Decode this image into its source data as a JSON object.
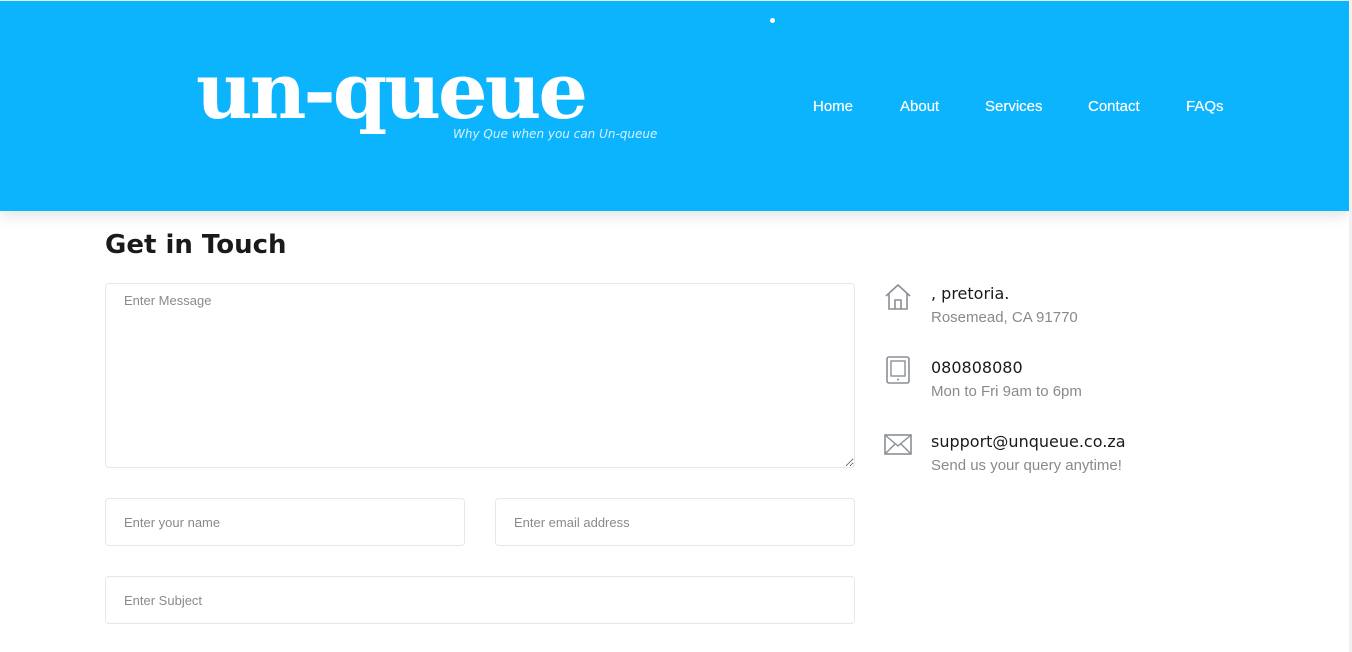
{
  "header": {
    "logo_text": "un-queue",
    "logo_tagline": "Why Que when you can Un-queue",
    "nav": [
      {
        "label": "Home"
      },
      {
        "label": "About"
      },
      {
        "label": "Services"
      },
      {
        "label": "Contact"
      },
      {
        "label": "FAQs"
      }
    ]
  },
  "contact": {
    "title": "Get in Touch",
    "form": {
      "message_placeholder": "Enter Message",
      "name_placeholder": "Enter your name",
      "email_placeholder": "Enter email address",
      "subject_placeholder": "Enter Subject"
    },
    "info": [
      {
        "icon": "home-icon",
        "title": ", pretoria.",
        "subtitle": "Rosemead, CA 91770"
      },
      {
        "icon": "tablet-icon",
        "title": "080808080",
        "subtitle": "Mon to Fri 9am to 6pm"
      },
      {
        "icon": "mail-icon",
        "title": "support@unqueue.co.za",
        "subtitle": "Send us your query anytime!"
      }
    ]
  },
  "colors": {
    "header_bg": "#0bb4fd",
    "text_dark": "#1a1a1a",
    "text_muted": "#8a8a8a"
  }
}
